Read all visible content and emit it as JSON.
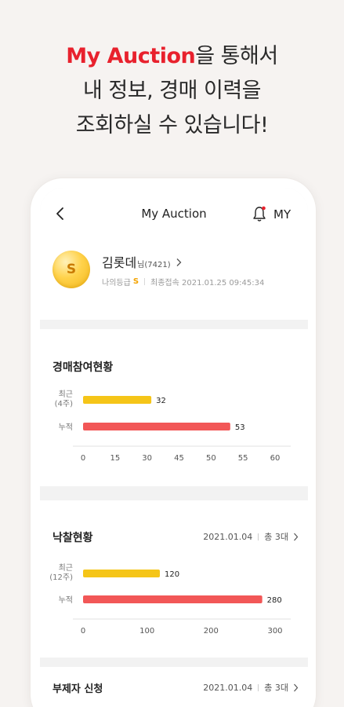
{
  "promo": {
    "brand": "My Auction",
    "line1_rest": "을 통해서",
    "line2": "내 정보, 경매 이력을",
    "line3": "조회하실 수 있습니다!"
  },
  "appbar": {
    "title": "My Auction",
    "my_label": "MY"
  },
  "profile": {
    "avatar_letter": "S",
    "name": "김롯데",
    "name_suffix": "님(7421)",
    "grade_label": "나의등급",
    "grade_value": "S",
    "last_login": "최종접속 2021.01.25 09:45:34"
  },
  "participation": {
    "title": "경매참여현황",
    "chart_data": {
      "type": "bar",
      "orientation": "horizontal",
      "categories": [
        "최근\n(4주)",
        "누적"
      ],
      "values": [
        32,
        53
      ],
      "xlim": [
        0,
        60
      ],
      "xticks": [
        0,
        15,
        30,
        45,
        50,
        55,
        60
      ],
      "colors": [
        "#f5c518",
        "#f25757"
      ],
      "data_labels": true
    }
  },
  "winning": {
    "title": "낙찰현황",
    "date": "2021.01.04",
    "total": "총 3대",
    "chart_data": {
      "type": "bar",
      "orientation": "horizontal",
      "categories": [
        "최근\n(12주)",
        "누적"
      ],
      "values": [
        120,
        280
      ],
      "xlim": [
        0,
        300
      ],
      "xticks": [
        0,
        100,
        200,
        300
      ],
      "colors": [
        "#f5c518",
        "#f25757"
      ],
      "data_labels": true
    }
  },
  "submission": {
    "title": "부제자 신청",
    "date": "2021.01.04",
    "total": "총 3대"
  },
  "colors": {
    "accent": "#e8212d",
    "grade": "#f3a300"
  },
  "icons": [
    "chevron-left-icon",
    "bell-icon",
    "chevron-right-icon"
  ]
}
